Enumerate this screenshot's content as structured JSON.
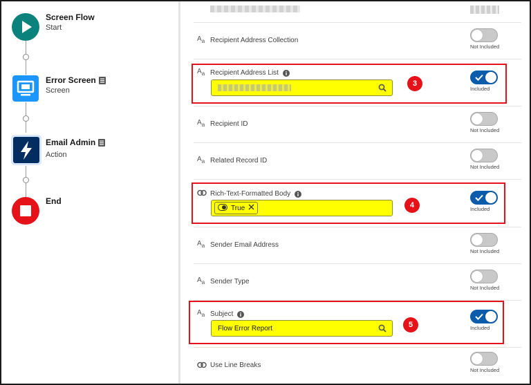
{
  "flow": {
    "nodes": [
      {
        "title": "Screen Flow",
        "subtitle": "Start",
        "icon": "play-icon",
        "color": "#0b827c"
      },
      {
        "title": "Error Screen",
        "subtitle": "Screen",
        "icon": "screen-icon",
        "color": "#1b96ff"
      },
      {
        "title": "Email Admin",
        "subtitle": "Action",
        "icon": "lightning-icon",
        "color": "#032d60"
      },
      {
        "title": "End",
        "subtitle": "",
        "icon": "stop-icon",
        "color": "#e5121a"
      }
    ]
  },
  "panel": {
    "rows": [
      {
        "label": "Recipient Address Collection",
        "type": "text",
        "included": false,
        "caption": "Not Included"
      },
      {
        "label": "Recipient Address List",
        "type": "text",
        "included": true,
        "caption": "Included",
        "value": "",
        "badge": "3"
      },
      {
        "label": "Recipient ID",
        "type": "text",
        "included": false,
        "caption": "Not Included"
      },
      {
        "label": "Related Record ID",
        "type": "text",
        "included": false,
        "caption": "Not Included"
      },
      {
        "label": "Rich-Text-Formatted Body",
        "type": "boolean",
        "included": true,
        "caption": "Included",
        "value": "True",
        "badge": "4"
      },
      {
        "label": "Sender Email Address",
        "type": "text",
        "included": false,
        "caption": "Not Included"
      },
      {
        "label": "Sender Type",
        "type": "text",
        "included": false,
        "caption": "Not Included"
      },
      {
        "label": "Subject",
        "type": "text",
        "included": true,
        "caption": "Included",
        "value": "Flow Error Report",
        "badge": "5"
      },
      {
        "label": "Use Line Breaks",
        "type": "boolean",
        "included": false,
        "caption": "Not Included"
      }
    ]
  },
  "colors": {
    "highlight": "#e5121a",
    "field_bg": "#ffff00",
    "toggle_on": "#0b5cab",
    "toggle_off": "#c9c9c9"
  }
}
